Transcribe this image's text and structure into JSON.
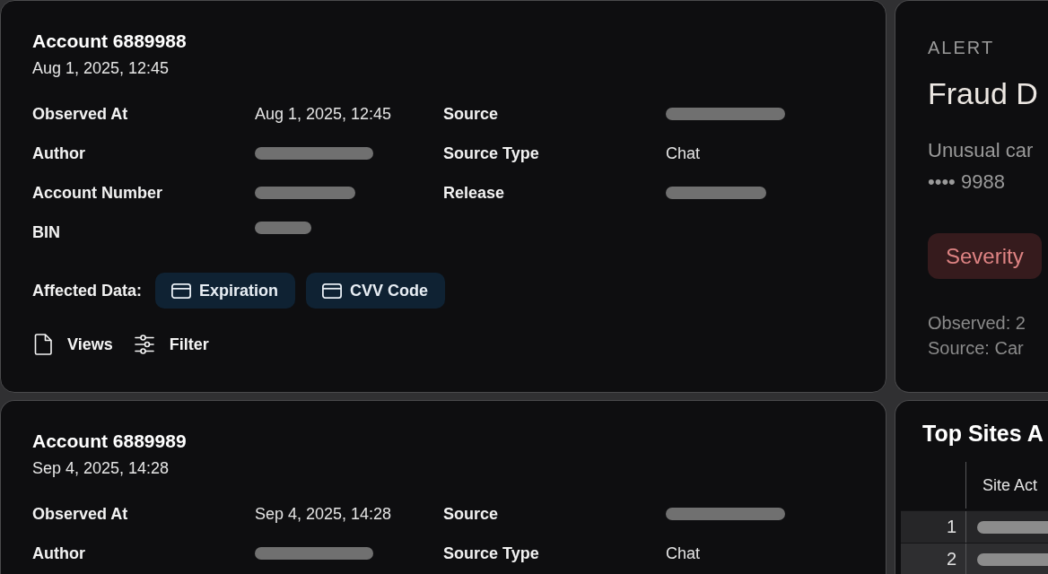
{
  "account_cards": [
    {
      "title": "Account 6889988",
      "date": "Aug 1, 2025, 12:45",
      "detail_columns": [
        {
          "fields": [
            {
              "label": "Observed At",
              "kind": "text",
              "value": "Aug 1, 2025, 12:45"
            },
            {
              "label": "Author",
              "kind": "redacted"
            },
            {
              "label": "Account Number",
              "kind": "redacted"
            },
            {
              "label": "BIN",
              "kind": "redacted"
            }
          ]
        },
        {
          "fields": [
            {
              "label": "Source",
              "kind": "redacted"
            },
            {
              "label": "Source Type",
              "kind": "text",
              "value": "Chat"
            },
            {
              "label": "Release",
              "kind": "redacted"
            }
          ]
        }
      ],
      "affected_data": {
        "label": "Affected Data:",
        "tags": [
          {
            "label": "Expiration"
          },
          {
            "label": "CVV Code"
          }
        ]
      },
      "actions": [
        {
          "label": "Views",
          "kind": "views"
        },
        {
          "label": "Filter",
          "kind": "filter"
        }
      ]
    },
    {
      "title": "Account 6889989",
      "date": "Sep 4, 2025, 14:28",
      "detail_columns": [
        {
          "fields": [
            {
              "label": "Observed At",
              "kind": "text",
              "value": "Sep 4, 2025, 14:28"
            },
            {
              "label": "Author",
              "kind": "redacted"
            }
          ]
        },
        {
          "fields": [
            {
              "label": "Source",
              "kind": "redacted"
            },
            {
              "label": "Source Type",
              "kind": "text",
              "value": "Chat"
            }
          ]
        }
      ]
    }
  ],
  "alert_card": {
    "eyebrow": "ALERT",
    "title": "Fraud D",
    "description_lines": [
      "Unusual car",
      "•••• 9988"
    ],
    "severity": {
      "label": "Severity"
    },
    "meta_lines": [
      "Observed: 2",
      "Source: Car"
    ]
  },
  "top_sites_card": {
    "title": "Top Sites A",
    "table": {
      "columns": [
        "Site Act"
      ],
      "rows": [
        {
          "number": "1",
          "site": {
            "kind": "redacted"
          }
        },
        {
          "number": "2",
          "site": {
            "kind": "redacted"
          }
        }
      ]
    }
  }
}
